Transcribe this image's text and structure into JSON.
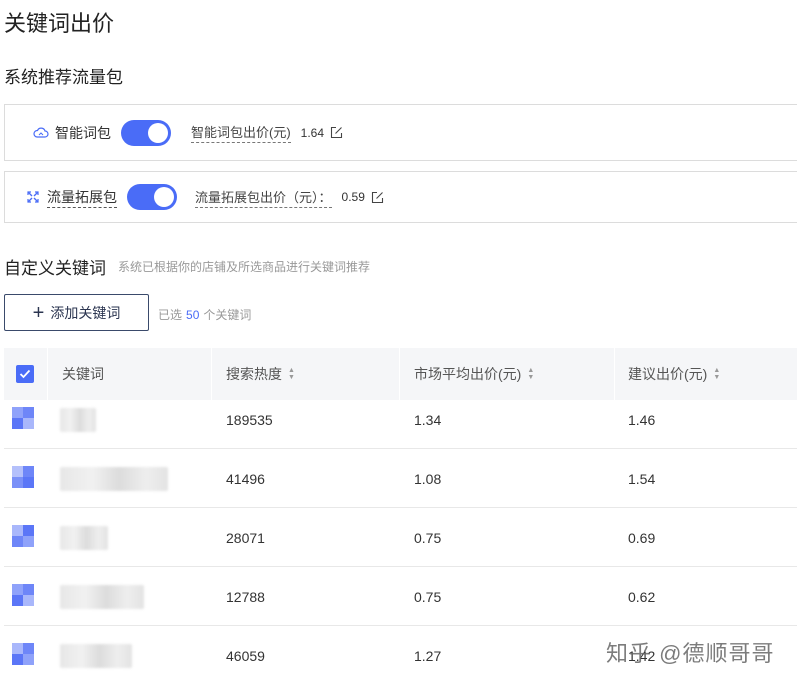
{
  "page": {
    "title": "关键词出价"
  },
  "system_packages": {
    "section_title": "系统推荐流量包",
    "smart": {
      "name": "智能词包",
      "price_label": "智能词包出价(元)",
      "price_value": "1.64",
      "enabled": true,
      "icon": "cloud-icon"
    },
    "expand": {
      "name": "流量拓展包",
      "price_label": "流量拓展包出价（元）：",
      "price_value": "0.59",
      "enabled": true,
      "icon": "expand-arrows-icon"
    }
  },
  "custom_keywords": {
    "title": "自定义关键词",
    "hint": "系统已根据你的店铺及所选商品进行关键词推荐",
    "add_button": "添加关键词",
    "selected_prefix": "已选",
    "selected_count": "50",
    "selected_suffix": "个关键词"
  },
  "table": {
    "columns": [
      "关键词",
      "搜索热度",
      "市场平均出价(元)",
      "建议出价(元)"
    ],
    "rows": [
      {
        "search_heat": "189535",
        "avg_bid": "1.34",
        "suggested_bid": "1.46"
      },
      {
        "search_heat": "41496",
        "avg_bid": "1.08",
        "suggested_bid": "1.54"
      },
      {
        "search_heat": "28071",
        "avg_bid": "0.75",
        "suggested_bid": "0.69"
      },
      {
        "search_heat": "12788",
        "avg_bid": "0.75",
        "suggested_bid": "0.62"
      },
      {
        "search_heat": "46059",
        "avg_bid": "1.27",
        "suggested_bid": "1.42"
      }
    ]
  },
  "watermark": "知乎 @德顺哥哥",
  "colors": {
    "accent": "#4a6cf7",
    "header_bg": "#f5f6f8",
    "border": "#dcdcdc"
  }
}
